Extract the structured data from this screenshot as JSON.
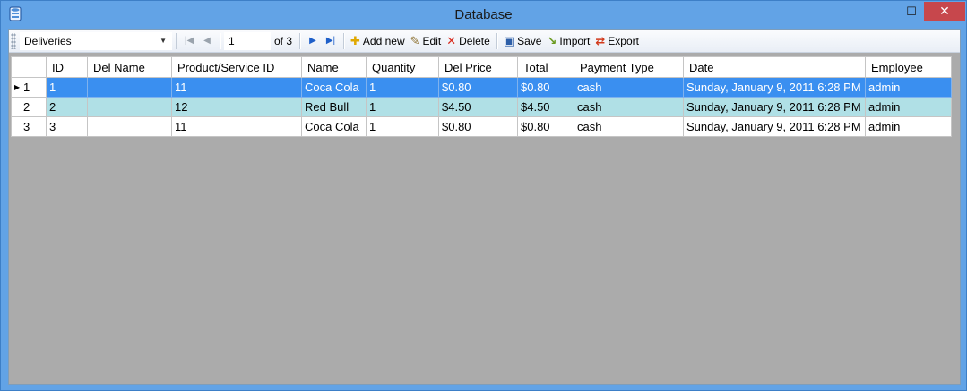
{
  "window": {
    "title": "Database",
    "minimize_glyph": "—",
    "maximize_glyph": "☐",
    "close_glyph": "✕"
  },
  "toolbar": {
    "table_selector": "Deliveries",
    "position": "1",
    "of_label": "of 3",
    "add_label": "Add new",
    "edit_label": "Edit",
    "delete_label": "Delete",
    "save_label": "Save",
    "import_label": "Import",
    "export_label": "Export"
  },
  "grid": {
    "columns": [
      "ID",
      "Del Name",
      "Product/Service ID",
      "Name",
      "Quantity",
      "Del Price",
      "Total",
      "Payment Type",
      "Date",
      "Employee"
    ],
    "rows": [
      {
        "num": "1",
        "cells": [
          "1",
          "",
          "11",
          "Coca Cola",
          "1",
          "$0.80",
          "$0.80",
          "cash",
          "Sunday, January 9, 2011 6:28 PM",
          "admin"
        ]
      },
      {
        "num": "2",
        "cells": [
          "2",
          "",
          "12",
          "Red Bull",
          "1",
          "$4.50",
          "$4.50",
          "cash",
          "Sunday, January 9, 2011 6:28 PM",
          "admin"
        ]
      },
      {
        "num": "3",
        "cells": [
          "3",
          "",
          "11",
          "Coca Cola",
          "1",
          "$0.80",
          "$0.80",
          "cash",
          "Sunday, January 9, 2011 6:28 PM",
          "admin"
        ]
      }
    ]
  },
  "colors": {
    "title_bar": "#62a3e6",
    "selected_row": "#3a8ff0",
    "alt_row": "#b0e0e6",
    "grid_background": "#ababab",
    "close_button": "#c7474c"
  },
  "icons": [
    "database-icon",
    "chevron-down-icon",
    "first-record-icon",
    "previous-record-icon",
    "next-record-icon",
    "last-record-icon",
    "add-icon",
    "edit-icon",
    "delete-icon",
    "save-icon",
    "import-icon",
    "export-icon",
    "current-row-icon"
  ]
}
